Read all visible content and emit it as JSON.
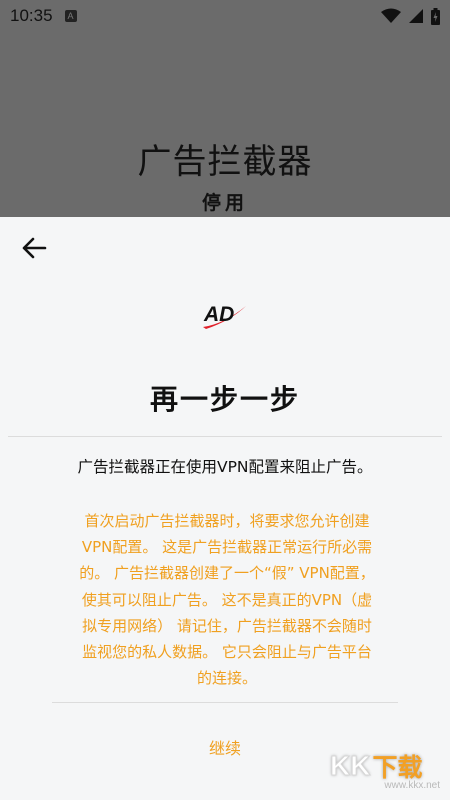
{
  "status_bar": {
    "time": "10:35",
    "notif_icon": "A"
  },
  "overlay": {
    "title": "广告拦截器",
    "subtitle": "停用"
  },
  "logo": {
    "text": "AD"
  },
  "heading": "再一步一步",
  "intro": "广告拦截器正在使用VPN配置来阻止广告。",
  "note_lines": [
    "首次启动广告拦截器时，将要求您允许创建",
    "VPN配置。 这是广告拦截器正常运行所必需",
    "的。 广告拦截器创建了一个“假” VPN配置，",
    "使其可以阻止广告。 这不是真正的VPN（虚",
    "拟专用网络） 请记住，广告拦截器不会随时",
    "监视您的私人数据。 它只会阻止与广告平台",
    "的连接。"
  ],
  "continue_label": "继续",
  "watermark": {
    "main": "KK",
    "accent": "下载",
    "url": "www.kkx.net"
  },
  "colors": {
    "accent": "#f0a020",
    "sheet_bg": "#f5f6f7",
    "overlay_bg": "#6b6b6b",
    "logo_red": "#e0202a"
  }
}
